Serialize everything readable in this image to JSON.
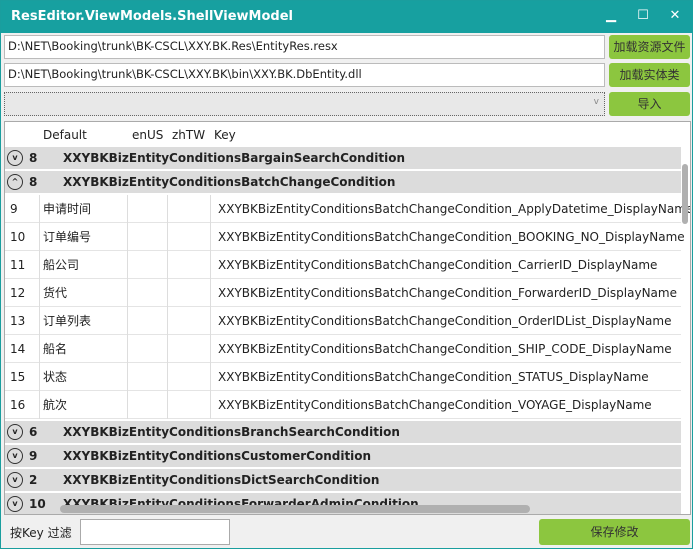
{
  "window": {
    "title": "ResEditor.ViewModels.ShellViewModel",
    "minimize": "▁",
    "maximize": "☐",
    "close": "✕"
  },
  "resource_path": "D:\\NET\\Booking\\trunk\\BK-CSCL\\XXY.BK.Res\\EntityRes.resx",
  "entity_path": "D:\\NET\\Booking\\trunk\\BK-CSCL\\XXY.BK\\bin\\XXY.BK.DbEntity.dll",
  "buttons": {
    "load_resource": "加载资源文件",
    "load_entity": "加载实体类",
    "import": "导入",
    "save": "保存修改"
  },
  "combo": {
    "value": "",
    "arrow": "v"
  },
  "grid": {
    "columns": [
      "Default",
      "enUS",
      "zhTW",
      "Key"
    ],
    "groups_top": [
      {
        "count": "8",
        "name": "XXYBKBizEntityConditionsBargainSearchCondition",
        "expanded": false
      },
      {
        "count": "8",
        "name": "XXYBKBizEntityConditionsBatchChangeCondition",
        "expanded": true
      }
    ],
    "rows": [
      {
        "n": "9",
        "default": "申请时间",
        "key": "XXYBKBizEntityConditionsBatchChangeCondition_ApplyDatetime_DisplayName"
      },
      {
        "n": "10",
        "default": "订单编号",
        "key": "XXYBKBizEntityConditionsBatchChangeCondition_BOOKING_NO_DisplayName"
      },
      {
        "n": "11",
        "default": "船公司",
        "key": "XXYBKBizEntityConditionsBatchChangeCondition_CarrierID_DisplayName"
      },
      {
        "n": "12",
        "default": "货代",
        "key": "XXYBKBizEntityConditionsBatchChangeCondition_ForwarderID_DisplayName"
      },
      {
        "n": "13",
        "default": "订单列表",
        "key": "XXYBKBizEntityConditionsBatchChangeCondition_OrderIDList_DisplayName"
      },
      {
        "n": "14",
        "default": "船名",
        "key": "XXYBKBizEntityConditionsBatchChangeCondition_SHIP_CODE_DisplayName"
      },
      {
        "n": "15",
        "default": "状态",
        "key": "XXYBKBizEntityConditionsBatchChangeCondition_STATUS_DisplayName"
      },
      {
        "n": "16",
        "default": "航次",
        "key": "XXYBKBizEntityConditionsBatchChangeCondition_VOYAGE_DisplayName"
      }
    ],
    "groups_bottom": [
      {
        "count": "6",
        "name": "XXYBKBizEntityConditionsBranchSearchCondition"
      },
      {
        "count": "9",
        "name": "XXYBKBizEntityConditionsCustomerCondition"
      },
      {
        "count": "2",
        "name": "XXYBKBizEntityConditionsDictSearchCondition"
      },
      {
        "count": "10",
        "name": "XXYBKBizEntityConditionsForwarderAdminCondition"
      }
    ]
  },
  "filter": {
    "label": "按Key 过滤",
    "value": ""
  },
  "colors": {
    "titlebar": "#17a0a0",
    "button": "#8cc63f",
    "group_row": "#dcdcdc"
  }
}
